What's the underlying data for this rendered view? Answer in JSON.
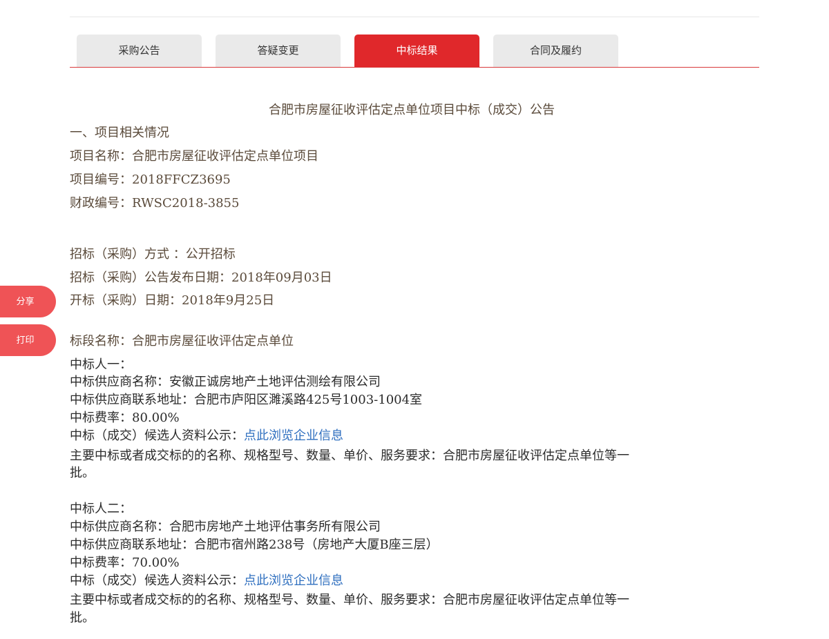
{
  "tabs": [
    {
      "label": "采购公告"
    },
    {
      "label": "答疑变更"
    },
    {
      "label": "中标结果"
    },
    {
      "label": "合同及履约"
    }
  ],
  "side": {
    "share": "分享",
    "print": "打印"
  },
  "notice": {
    "title": "合肥市房屋征收评估定点单位项目中标（成交）公告",
    "section1": "一、项目相关情况",
    "project_name": "项目名称：合肥市房屋征收评估定点单位项目",
    "project_no": "项目编号：2018FFCZ3695",
    "finance_no": "财政编号：RWSC2018-3855",
    "method": "招标（采购）方式 ：公开招标",
    "publish_date": "招标（采购）公告发布日期：2018年09月03日",
    "open_date": "开标（采购）日期：2018年9月25日",
    "lot_name": "标段名称：合肥市房屋征收评估定点单位"
  },
  "winners": [
    {
      "heading": "中标人一：",
      "supplier": "中标供应商名称：安徽正诚房地产土地评估测绘有限公司",
      "address": "中标供应商联系地址：合肥市庐阳区濉溪路425号1003-1004室",
      "rate": "中标费率：80.00%",
      "disclosure_label": "中标（成交）候选人资料公示：",
      "disclosure_link": "点此浏览企业信息",
      "requirements_1": "主要中标或者成交标的的名称、规格型号、数量、单价、服务要求：合肥市房屋征收评估定点单位等一",
      "requirements_2": "批。"
    },
    {
      "heading": "中标人二：",
      "supplier": "中标供应商名称：合肥市房地产土地评估事务所有限公司",
      "address": "中标供应商联系地址：合肥市宿州路238号（房地产大厦B座三层）",
      "rate": "中标费率：70.00%",
      "disclosure_label": "中标（成交）候选人资料公示：",
      "disclosure_link": "点此浏览企业信息",
      "requirements_1": "主要中标或者成交标的的名称、规格型号、数量、单价、服务要求：合肥市房屋征收评估定点单位等一",
      "requirements_2": "批。"
    }
  ],
  "colors": {
    "accent": "#e0282b",
    "side_button": "#ef5356",
    "link": "#2f6fbf",
    "body_text": "#5a4a3a"
  }
}
